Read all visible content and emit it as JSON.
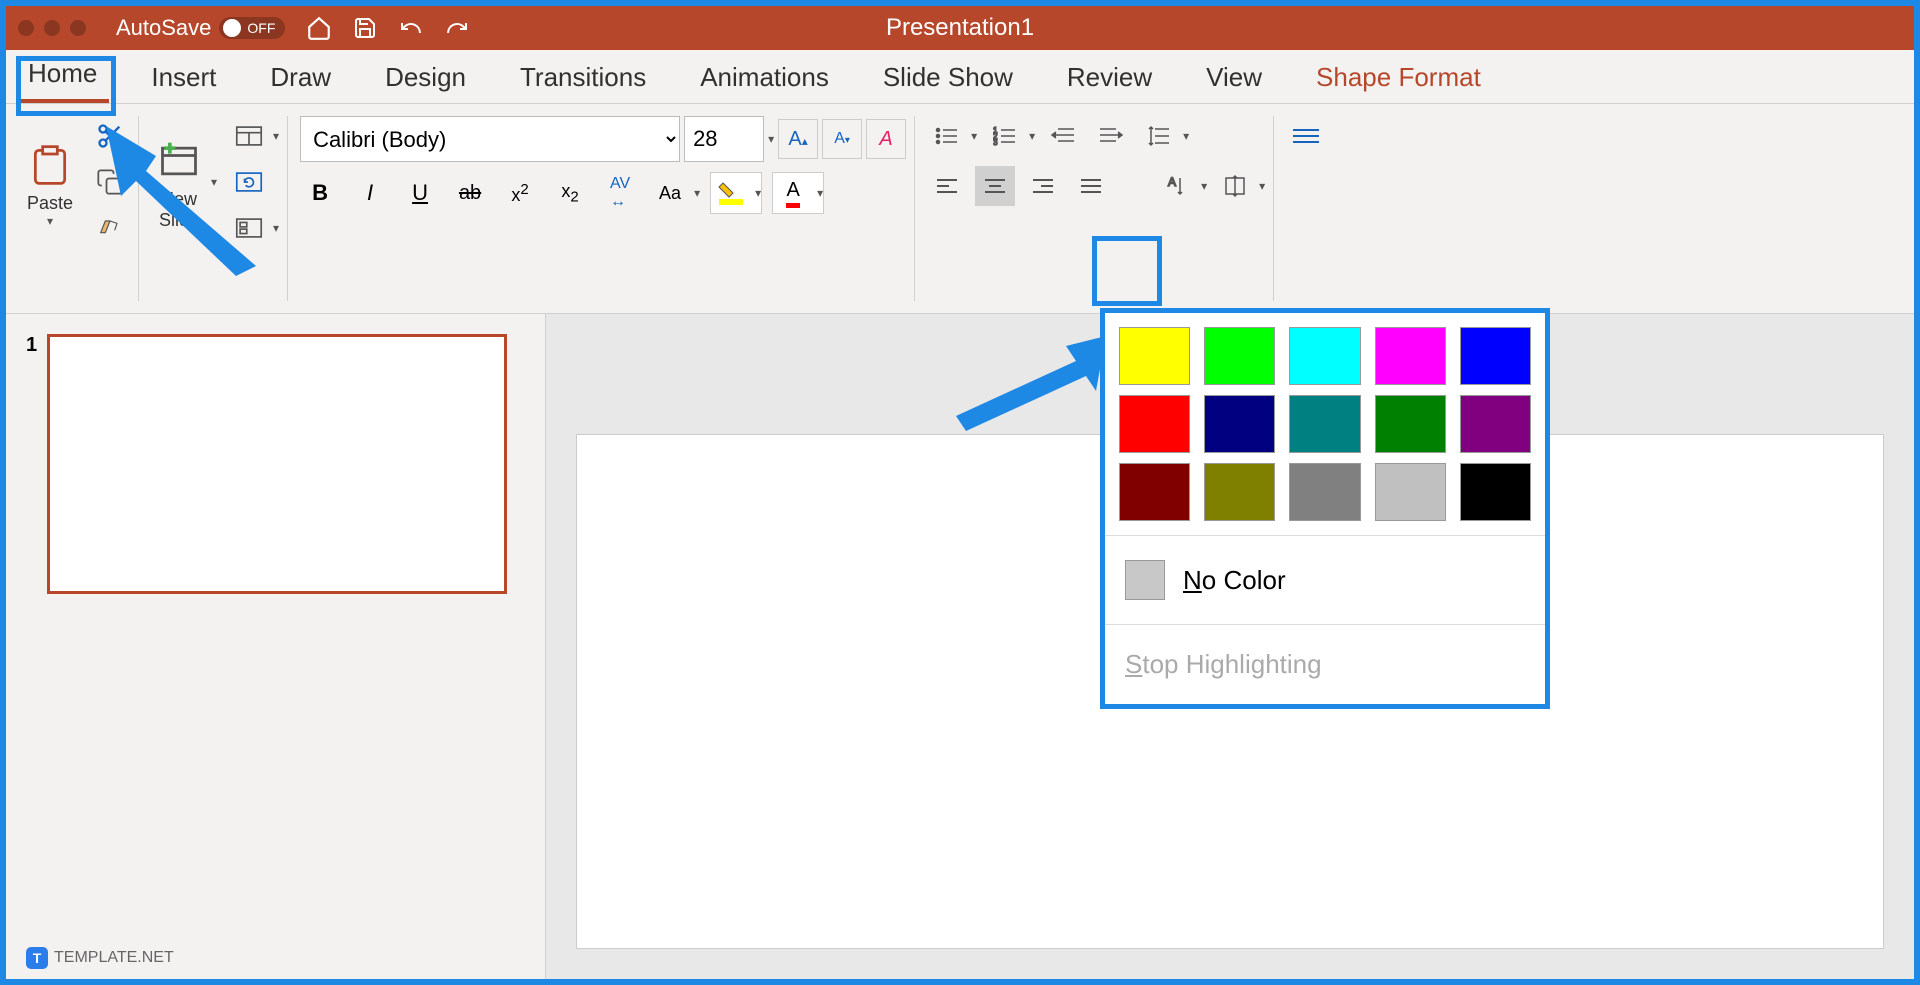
{
  "titlebar": {
    "autosave_label": "AutoSave",
    "autosave_state": "OFF",
    "doc_title": "Presentation1"
  },
  "tabs": {
    "home": "Home",
    "insert": "Insert",
    "draw": "Draw",
    "design": "Design",
    "transitions": "Transitions",
    "animations": "Animations",
    "slideshow": "Slide Show",
    "review": "Review",
    "view": "View",
    "shapeformat": "Shape Format"
  },
  "ribbon": {
    "paste": "Paste",
    "newslide": "New\nSlide",
    "font_name": "Calibri (Body)",
    "font_size": "28"
  },
  "thumb": {
    "num": "1"
  },
  "colordd": {
    "nocolor": "No Color",
    "stop": "Stop Highlighting",
    "rows": [
      [
        "#FFFF00",
        "#00FF00",
        "#00FFFF",
        "#FF00FF",
        "#0000FF"
      ],
      [
        "#FF0000",
        "#000080",
        "#008080",
        "#008000",
        "#800080"
      ],
      [
        "#800000",
        "#808000",
        "#808080",
        "#C0C0C0",
        "#000000"
      ]
    ]
  },
  "watermark": {
    "text": "TEMPLATE.NET"
  }
}
